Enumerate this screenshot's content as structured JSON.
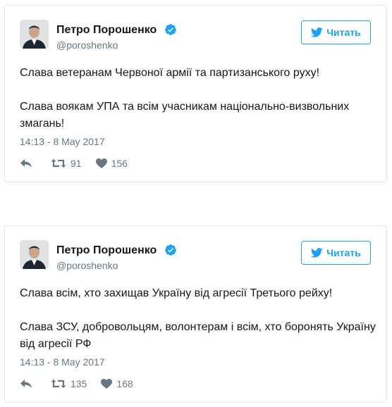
{
  "tweets": [
    {
      "author_name": "Петро Порошенко",
      "handle": "@poroshenko",
      "follow_label": "Читать",
      "paragraphs": [
        "Слава ветеранам Червоної армії та партизанського руху!",
        "Слава воякам УПА та всім учасникам національно-визвольних змагань!"
      ],
      "timestamp": "14:13 - 8 May 2017",
      "retweets": "91",
      "likes": "156"
    },
    {
      "author_name": "Петро Порошенко",
      "handle": "@poroshenko",
      "follow_label": "Читать",
      "paragraphs": [
        "Слава всім, хто захищав Україну від агресії Третього рейху!",
        "Слава ЗСУ, добровольцям, волонтерам і всім, хто боронять Україну від агресії РФ"
      ],
      "timestamp": "14:13 - 8 May 2017",
      "retweets": "135",
      "likes": "168"
    }
  ],
  "colors": {
    "accent": "#1da1f2",
    "muted": "#657786",
    "text": "#14171a",
    "border": "#e1e8ed"
  },
  "icons": [
    "verified-badge-icon",
    "twitter-bird-icon",
    "reply-icon",
    "retweet-icon",
    "heart-icon"
  ]
}
